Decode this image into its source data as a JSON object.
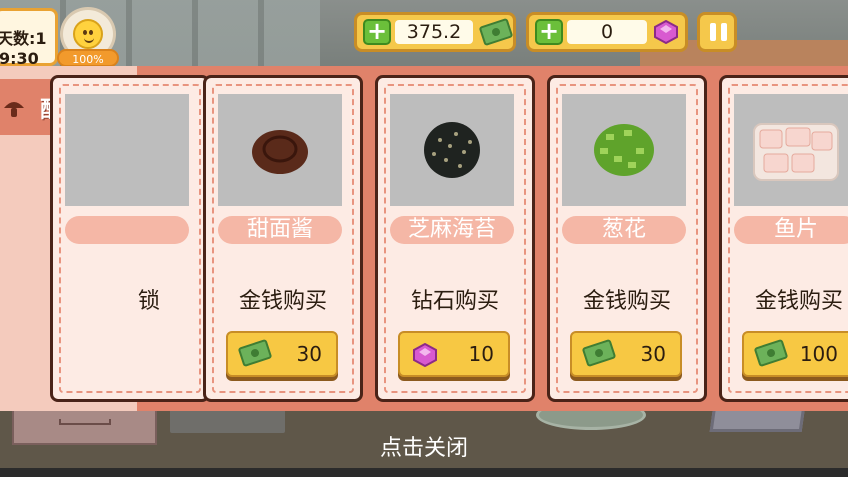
{
  "hud": {
    "day": "天数:1",
    "time": "9:30",
    "mood_percent": "100%",
    "money": "375.2",
    "gems": "0"
  },
  "sidebar": {
    "category_label": "配料"
  },
  "cards": [
    {
      "name": "",
      "buy_text": "锁"
    },
    {
      "name": "甜面酱",
      "buy_text": "金钱购买",
      "price": "30",
      "currency": "money"
    },
    {
      "name": "芝麻海苔",
      "buy_text": "钻石购买",
      "price": "10",
      "currency": "gem"
    },
    {
      "name": "葱花",
      "buy_text": "金钱购买",
      "price": "30",
      "currency": "money"
    },
    {
      "name": "鱼片",
      "buy_text": "金钱购买",
      "price": "100",
      "currency": "money"
    }
  ],
  "close_hint": "点击关闭",
  "colors": {
    "panel": "#e0826a",
    "sidebar": "#f4cbbd",
    "card": "#fdebe4",
    "price_button": "#f7c843"
  }
}
